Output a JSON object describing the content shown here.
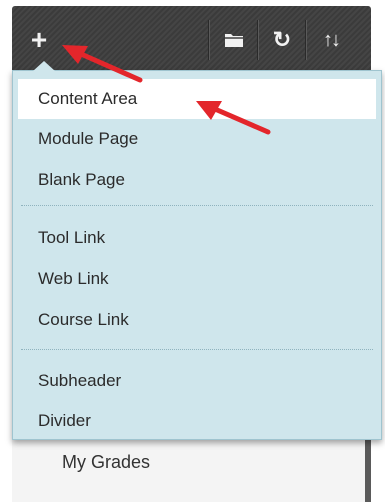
{
  "toolbar": {
    "add_glyph": "+",
    "refresh_glyph": "↻",
    "sort_glyph": "↑↓"
  },
  "menu": {
    "groups": [
      {
        "items": [
          "Content Area",
          "Module Page",
          "Blank Page"
        ]
      },
      {
        "items": [
          "Tool Link",
          "Web Link",
          "Course Link"
        ]
      },
      {
        "items": [
          "Subheader",
          "Divider"
        ]
      }
    ],
    "highlighted_item": "Content Area"
  },
  "sidebar": {
    "my_grades_label": "My Grades"
  },
  "colors": {
    "menu_background": "#cfe6ec",
    "annotation_arrow": "#e3262b",
    "toolbar_background": "#3f3f3f"
  }
}
